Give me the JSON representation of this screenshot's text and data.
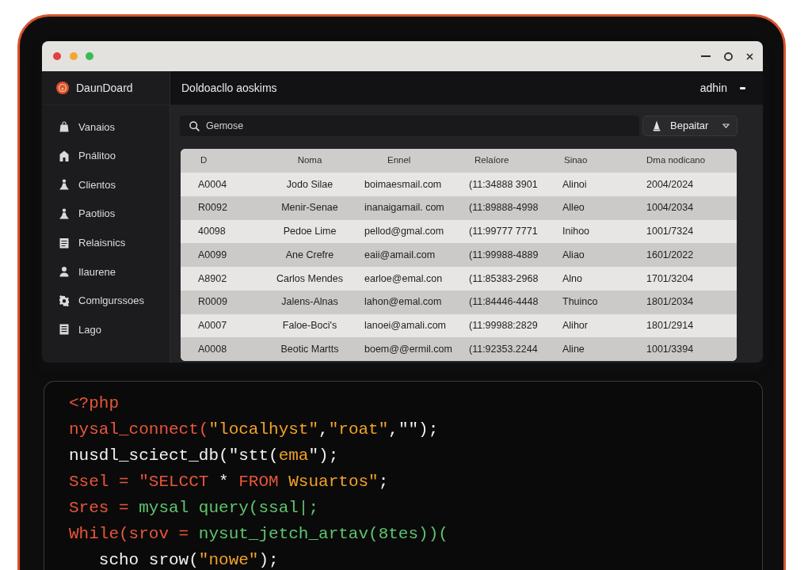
{
  "sidebar": {
    "brand": "DaunDoard",
    "items": [
      {
        "label": "Vanaios"
      },
      {
        "label": "Pnálitoo"
      },
      {
        "label": "Clientos"
      },
      {
        "label": "Paotiios"
      },
      {
        "label": "Relaisnics"
      },
      {
        "label": "Ilaurene"
      },
      {
        "label": "Comlgurssoes"
      },
      {
        "label": "Lago"
      }
    ]
  },
  "header": {
    "title": "Doldoacllo aoskims",
    "user": "adhin"
  },
  "toolbar": {
    "search": {
      "placeholder": "Gemose"
    },
    "button": "Bepaitar"
  },
  "table": {
    "columns": [
      "D",
      "Noma",
      "Ennel",
      "Relaíore",
      "Sinao",
      "Dma nodicano"
    ],
    "rows": [
      [
        "A0004",
        "Jodo Silae",
        "boimaesmail.com",
        "(11:34888 3901",
        "Alinoi",
        "2004/2024"
      ],
      [
        "R0092",
        "Menir-Senae",
        "inanaigamail. com",
        "(11:89888-4998",
        "Alleo",
        "1004/2034"
      ],
      [
        "40098",
        "Pedoe Lime",
        "pellod@gmal.com",
        "(11:99777 7771",
        "Inihoo",
        "1001/7324"
      ],
      [
        "A0099",
        "Ane Crefre",
        "eaii@amail.com",
        "(11:99988-4889",
        "Aliao",
        "1601/2022"
      ],
      [
        "A8902",
        "Carlos Mendes",
        "earloe@emal.con",
        "(11:85383-2968",
        "Alno",
        "1701/3204"
      ],
      [
        "R0009",
        "Jalens-Alnas",
        "lahon@emal.com",
        "(11:84446-4448",
        "Thuinco",
        "1801/2034"
      ],
      [
        "A0007",
        "Faloe-Boci's",
        "lanoei@amali.com",
        "(11:99988:2829",
        "Alihor",
        "1801/2914"
      ],
      [
        "A0008",
        "Beotic Martts",
        "boem@@ermil.com",
        "(11:92353.2244",
        "Aline",
        "1001/3394"
      ]
    ]
  },
  "code": {
    "lines": [
      {
        "indented": false,
        "segments": [
          {
            "text": "<?php",
            "kind": "keyword"
          }
        ]
      },
      {
        "indented": false,
        "segments": [
          {
            "text": "nysal_connect(",
            "kind": "keyword"
          },
          {
            "text": "\"localhyst\"",
            "kind": "string"
          },
          {
            "text": ",",
            "kind": "plain"
          },
          {
            "text": "\"roat\"",
            "kind": "string"
          },
          {
            "text": ",\"\");",
            "kind": "plain"
          }
        ]
      },
      {
        "indented": false,
        "segments": [
          {
            "text": "nusdl_sciect_db(\"stt(",
            "kind": "plain"
          },
          {
            "text": "ema",
            "kind": "string"
          },
          {
            "text": "\");",
            "kind": "plain"
          }
        ]
      },
      {
        "indented": false,
        "segments": [
          {
            "text": "Ssel = \"SELCCT",
            "kind": "keyword"
          },
          {
            "text": " * ",
            "kind": "plain"
          },
          {
            "text": "FROM ",
            "kind": "keyword"
          },
          {
            "text": "Wsuartos\"",
            "kind": "string"
          },
          {
            "text": ";",
            "kind": "plain"
          }
        ]
      },
      {
        "indented": false,
        "segments": [
          {
            "text": "Sres = ",
            "kind": "keyword"
          },
          {
            "text": "mysal query(ssal|;",
            "kind": "call"
          }
        ]
      },
      {
        "indented": false,
        "segments": [
          {
            "text": "While(srov = ",
            "kind": "keyword"
          },
          {
            "text": "nysut_jetch_artav(8tes))(",
            "kind": "call"
          }
        ]
      },
      {
        "indented": true,
        "segments": [
          {
            "text": "scho srow(",
            "kind": "plain"
          },
          {
            "text": "\"nowe\"",
            "kind": "string"
          },
          {
            "text": ");",
            "kind": "plain"
          }
        ]
      }
    ]
  }
}
